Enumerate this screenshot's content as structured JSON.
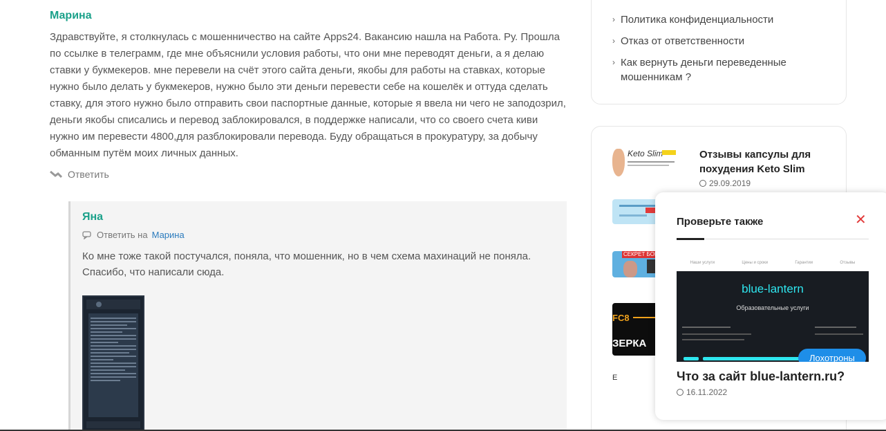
{
  "comments": [
    {
      "author": "Марина",
      "text": "Здравствуйте, я столкнулась с мошенничество на сайте Apps24. Вакансию нашла на Работа. Ру. Прошла по ссылке в телеграмм, где мне объяснили условия работы, что они мне переводят деньги, а я делаю ставки у букмекеров. мне перевели на счёт этого сайта деньги, якобы для работы на ставках, которые нужно было делать у букмекеров, нужно было эти деньги перевести себе на кошелёк и оттуда сделать ставку, для этого нужно было отправить свои паспортные данные, которые я ввела ни чего не заподозрил, деньги якобы списались и перевод заблокировался, в поддержке написали, что со своего счета киви нужно им перевести 4800,для разблокировали перевода. Буду обращаться в прокуратуру, за добычу обманным путём моих личных данных.",
      "reply_label": "Ответить"
    },
    {
      "author": "Яна",
      "reply_to_label": "Ответить на",
      "reply_to_name": "Марина",
      "text": "Ко мне тоже такой постучался, поняла, что мошенник, но в чем схема махинаций не поняла. Спасибо, что написали сюда."
    }
  ],
  "sidebar": {
    "menu": [
      "Политика конфиденциальности",
      "Отказ от ответственности",
      "Как вернуть деньги переведенные мошенникам ?"
    ],
    "posts": [
      {
        "title": "Отзывы капсулы для похудения Keto Slim",
        "date": "29.09.2019",
        "thumb_text": "Keto Slim"
      },
      {
        "thumb_text": ""
      },
      {
        "thumb_text": "СЕКРЕТ БОГАТС"
      },
      {
        "thumb_text": "FC8 ЗЕРКА"
      }
    ],
    "partial_text": "E"
  },
  "popup": {
    "title": "Проверьте также",
    "close_symbol": "✕",
    "image": {
      "nav": [
        "Наши услуги",
        "Цены и сроки",
        "Гарантии",
        "Отзывы"
      ],
      "brand": "blue-lantern",
      "subtitle": "Образовательные услуги",
      "badge": "Лохотроны"
    },
    "post_title": "Что за сайт blue-lantern.ru?",
    "post_date": "16.11.2022"
  },
  "colors": {
    "author": "#1ba18a",
    "link": "#2b7bbd",
    "close": "#e23b3b",
    "badge": "#1e8ee8",
    "brand": "#2ee6ef"
  }
}
